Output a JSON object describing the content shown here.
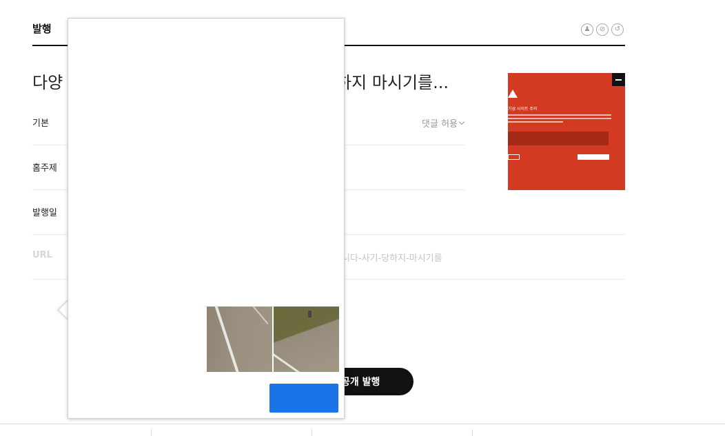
{
  "header": {
    "title": "발행",
    "icons": [
      "accessibility-icon",
      "no-money-icon",
      "history-icon"
    ]
  },
  "post": {
    "title_start": "다양",
    "title_tail": "하지 마시기를..."
  },
  "rows": {
    "basic": {
      "label": "기본",
      "comment_toggle": "댓글 허용"
    },
    "topic": {
      "label": "홈주제"
    },
    "date": {
      "label": "발행일"
    },
    "url": {
      "label": "URL",
      "value": "습니다-사기-당하지-마시기를"
    }
  },
  "thumbnail": {
    "warning_title": "기성 사이트 주의",
    "colors": {
      "background": "#d23a22",
      "box": "#a42a15"
    }
  },
  "publish": {
    "label": "공개 발행"
  },
  "popup": {
    "colors": {
      "verify_button": "#1a73e8"
    }
  }
}
